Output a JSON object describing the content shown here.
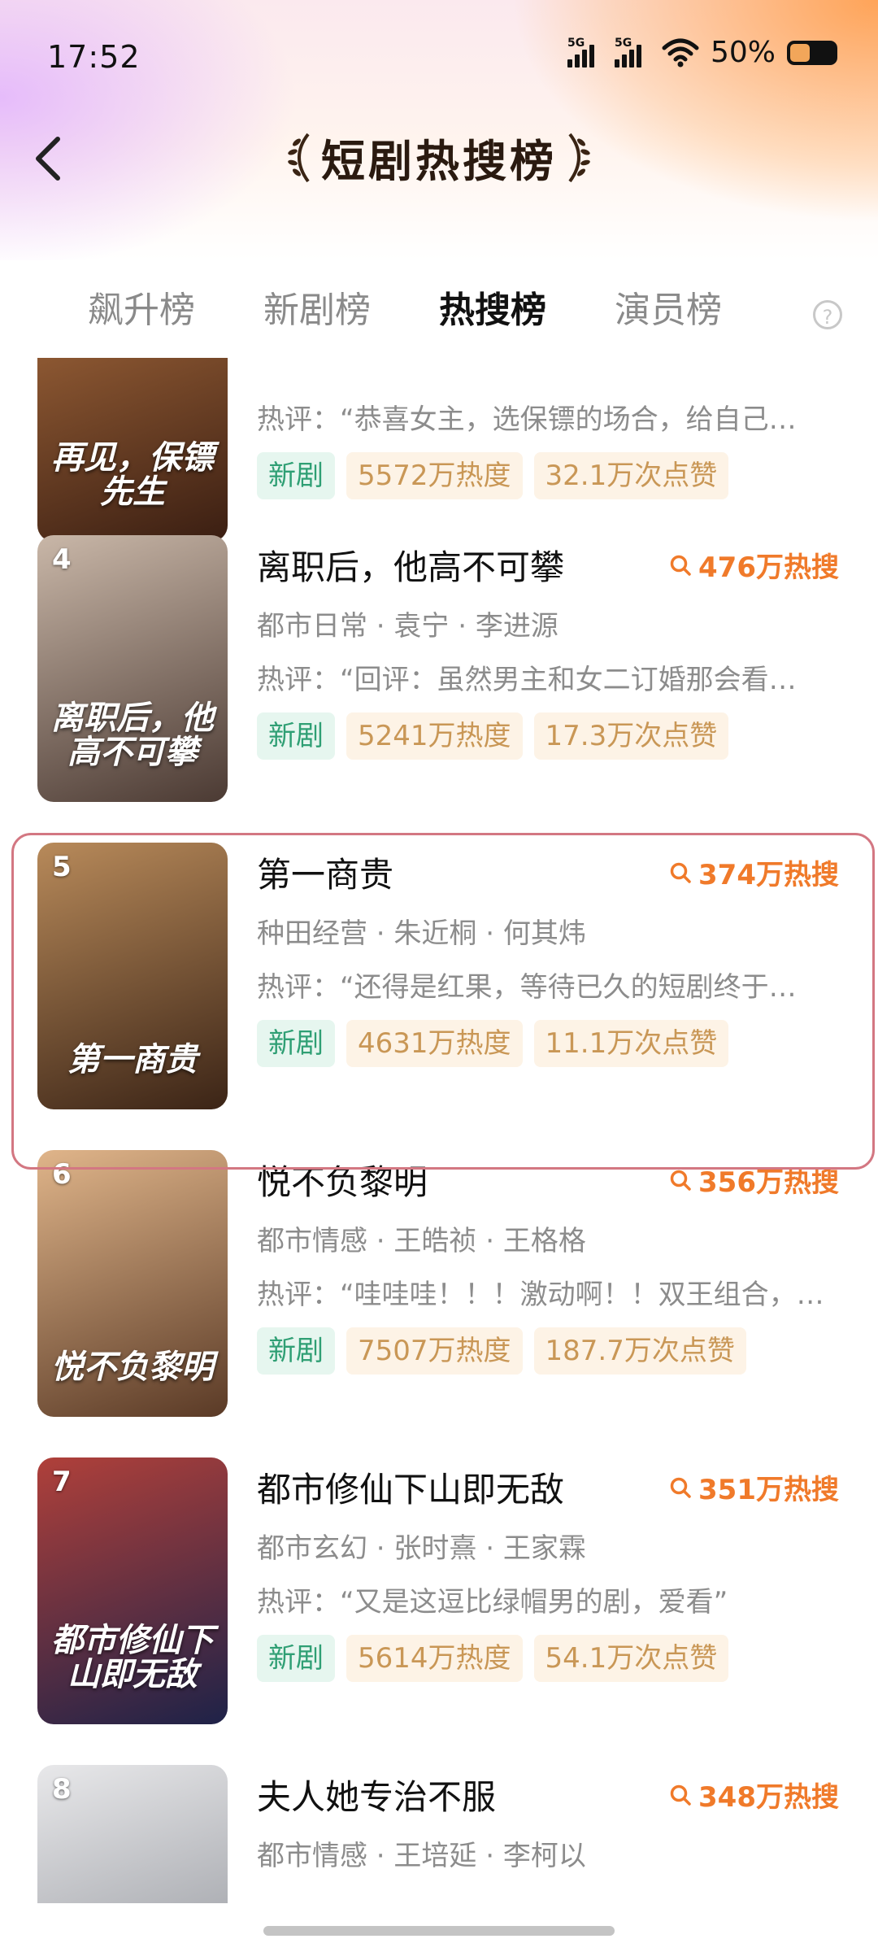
{
  "status_bar": {
    "time": "17:52",
    "signal_1": "5G",
    "signal_2": "5G",
    "battery": "50%"
  },
  "nav": {
    "title": "短剧热搜榜",
    "back_icon": "chevron-left-icon"
  },
  "tabs": [
    {
      "label": "飙升榜",
      "active": false
    },
    {
      "label": "新剧榜",
      "active": false
    },
    {
      "label": "热搜榜",
      "active": true
    },
    {
      "label": "演员榜",
      "active": false
    }
  ],
  "items": [
    {
      "rank": "",
      "title": "",
      "hot": "",
      "meta": "",
      "comment": "热评：“恭喜女主，选保镖的场合，给自己…",
      "tag_new": "新剧",
      "heat": "5572万热度",
      "likes": "32.1万次点赞",
      "poster_text": "再见，保镖先生",
      "poster_colors": [
        "#3a1e12",
        "#a76a3c"
      ]
    },
    {
      "rank": "4",
      "title": "离职后，他高不可攀",
      "hot": "476万热搜",
      "meta": "都市日常 · 袁宁 · 李进源",
      "comment": "热评：“回评：虽然男主和女二订婚那会看…",
      "tag_new": "新剧",
      "heat": "5241万热度",
      "likes": "17.3万次点赞",
      "poster_text": "离职后，他高不可攀",
      "poster_colors": [
        "#4b3a33",
        "#c9b7a8"
      ]
    },
    {
      "rank": "5",
      "title": "第一商贵",
      "hot": "374万热搜",
      "meta": "种田经营 · 朱近桐 · 何其炜",
      "comment": "热评：“还得是红果，等待已久的短剧终于…",
      "tag_new": "新剧",
      "heat": "4631万热度",
      "likes": "11.1万次点赞",
      "poster_text": "第一商贵",
      "poster_colors": [
        "#3b2416",
        "#b88a5a"
      ]
    },
    {
      "rank": "6",
      "title": "悦不负黎明",
      "hot": "356万热搜",
      "meta": "都市情感 · 王皓祯 · 王格格",
      "comment": "热评：“哇哇哇！！！激动啊！！双王组合，…",
      "tag_new": "新剧",
      "heat": "7507万热度",
      "likes": "187.7万次点赞",
      "poster_text": "悦不负黎明",
      "poster_colors": [
        "#5a3a26",
        "#e0b58a"
      ]
    },
    {
      "rank": "7",
      "title": "都市修仙下山即无敌",
      "hot": "351万热搜",
      "meta": "都市玄幻 · 张时熹 · 王家霖",
      "comment": "热评：“又是这逗比绿帽男的剧，爱看”",
      "tag_new": "新剧",
      "heat": "5614万热度",
      "likes": "54.1万次点赞",
      "poster_text": "都市修仙下山即无敌",
      "poster_colors": [
        "#1e2248",
        "#b0403a"
      ]
    },
    {
      "rank": "8",
      "title": "夫人她专治不服",
      "hot": "348万热搜",
      "meta": "都市情感 · 王培延 · 李柯以",
      "comment": "",
      "tag_new": "",
      "heat": "",
      "likes": "",
      "poster_text": "",
      "poster_colors": [
        "#8c8f96",
        "#e8e8ea"
      ]
    }
  ]
}
